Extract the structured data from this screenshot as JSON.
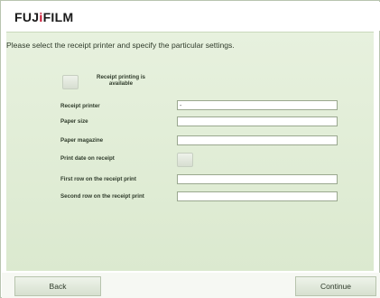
{
  "brand": {
    "logo_prefix": "FUJ",
    "logo_i": "i",
    "logo_suffix": "FILM"
  },
  "instruction": "Please select the receipt printer and specify the particular settings.",
  "receipt_printing": {
    "label_line1": "Receipt printing is",
    "label_line2": "available",
    "checked": false
  },
  "fields": [
    {
      "label": "Receipt printer",
      "value": "-"
    },
    {
      "label": "Paper size",
      "value": ""
    },
    {
      "label": "Paper magazine",
      "value": ""
    },
    {
      "label": "Print date on receipt",
      "checked": false
    },
    {
      "label": "First row on the receipt print",
      "value": ""
    },
    {
      "label": "Second row on the receipt print",
      "value": ""
    }
  ],
  "buttons": {
    "back": "Back",
    "continue": "Continue"
  },
  "colors": {
    "panel": "#dbe9cf",
    "brand_red": "#c8102e"
  }
}
